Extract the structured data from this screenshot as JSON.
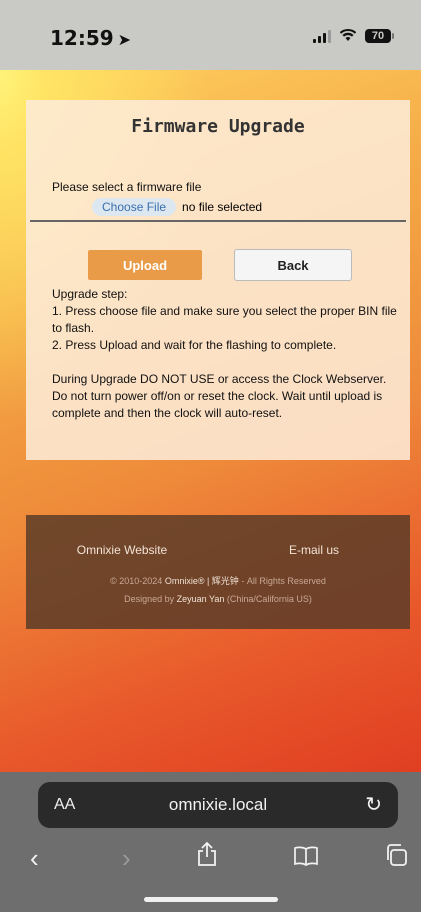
{
  "status": {
    "time": "12:59",
    "battery": "70"
  },
  "card": {
    "title": "Firmware Upgrade",
    "select_label": "Please select a firmware file",
    "choose_file": "Choose File",
    "no_file": "no file selected",
    "upload": "Upload",
    "back": "Back",
    "steps": [
      "Upgrade step:",
      "1. Press choose file and make sure you select the proper BIN file to flash.",
      "2. Press Upload and wait for the flashing to complete.",
      "During Upgrade DO NOT USE or access the Clock Webserver. Do not turn power off/on or reset the clock. Wait until upload is complete and then the clock will auto-reset."
    ]
  },
  "footer": {
    "website": "Omnixie Website",
    "email": "E-mail us",
    "copyright_prefix": "© 2010-2024",
    "brand": "Omnixie® | 辉光钟",
    "copyright_suffix": "- All Rights Reserved",
    "designed_prefix": "Designed by",
    "designer": "Zeyuan Yan",
    "location": "(China/California US)"
  },
  "browser": {
    "aa": "AA",
    "url": "omnixie.local"
  }
}
